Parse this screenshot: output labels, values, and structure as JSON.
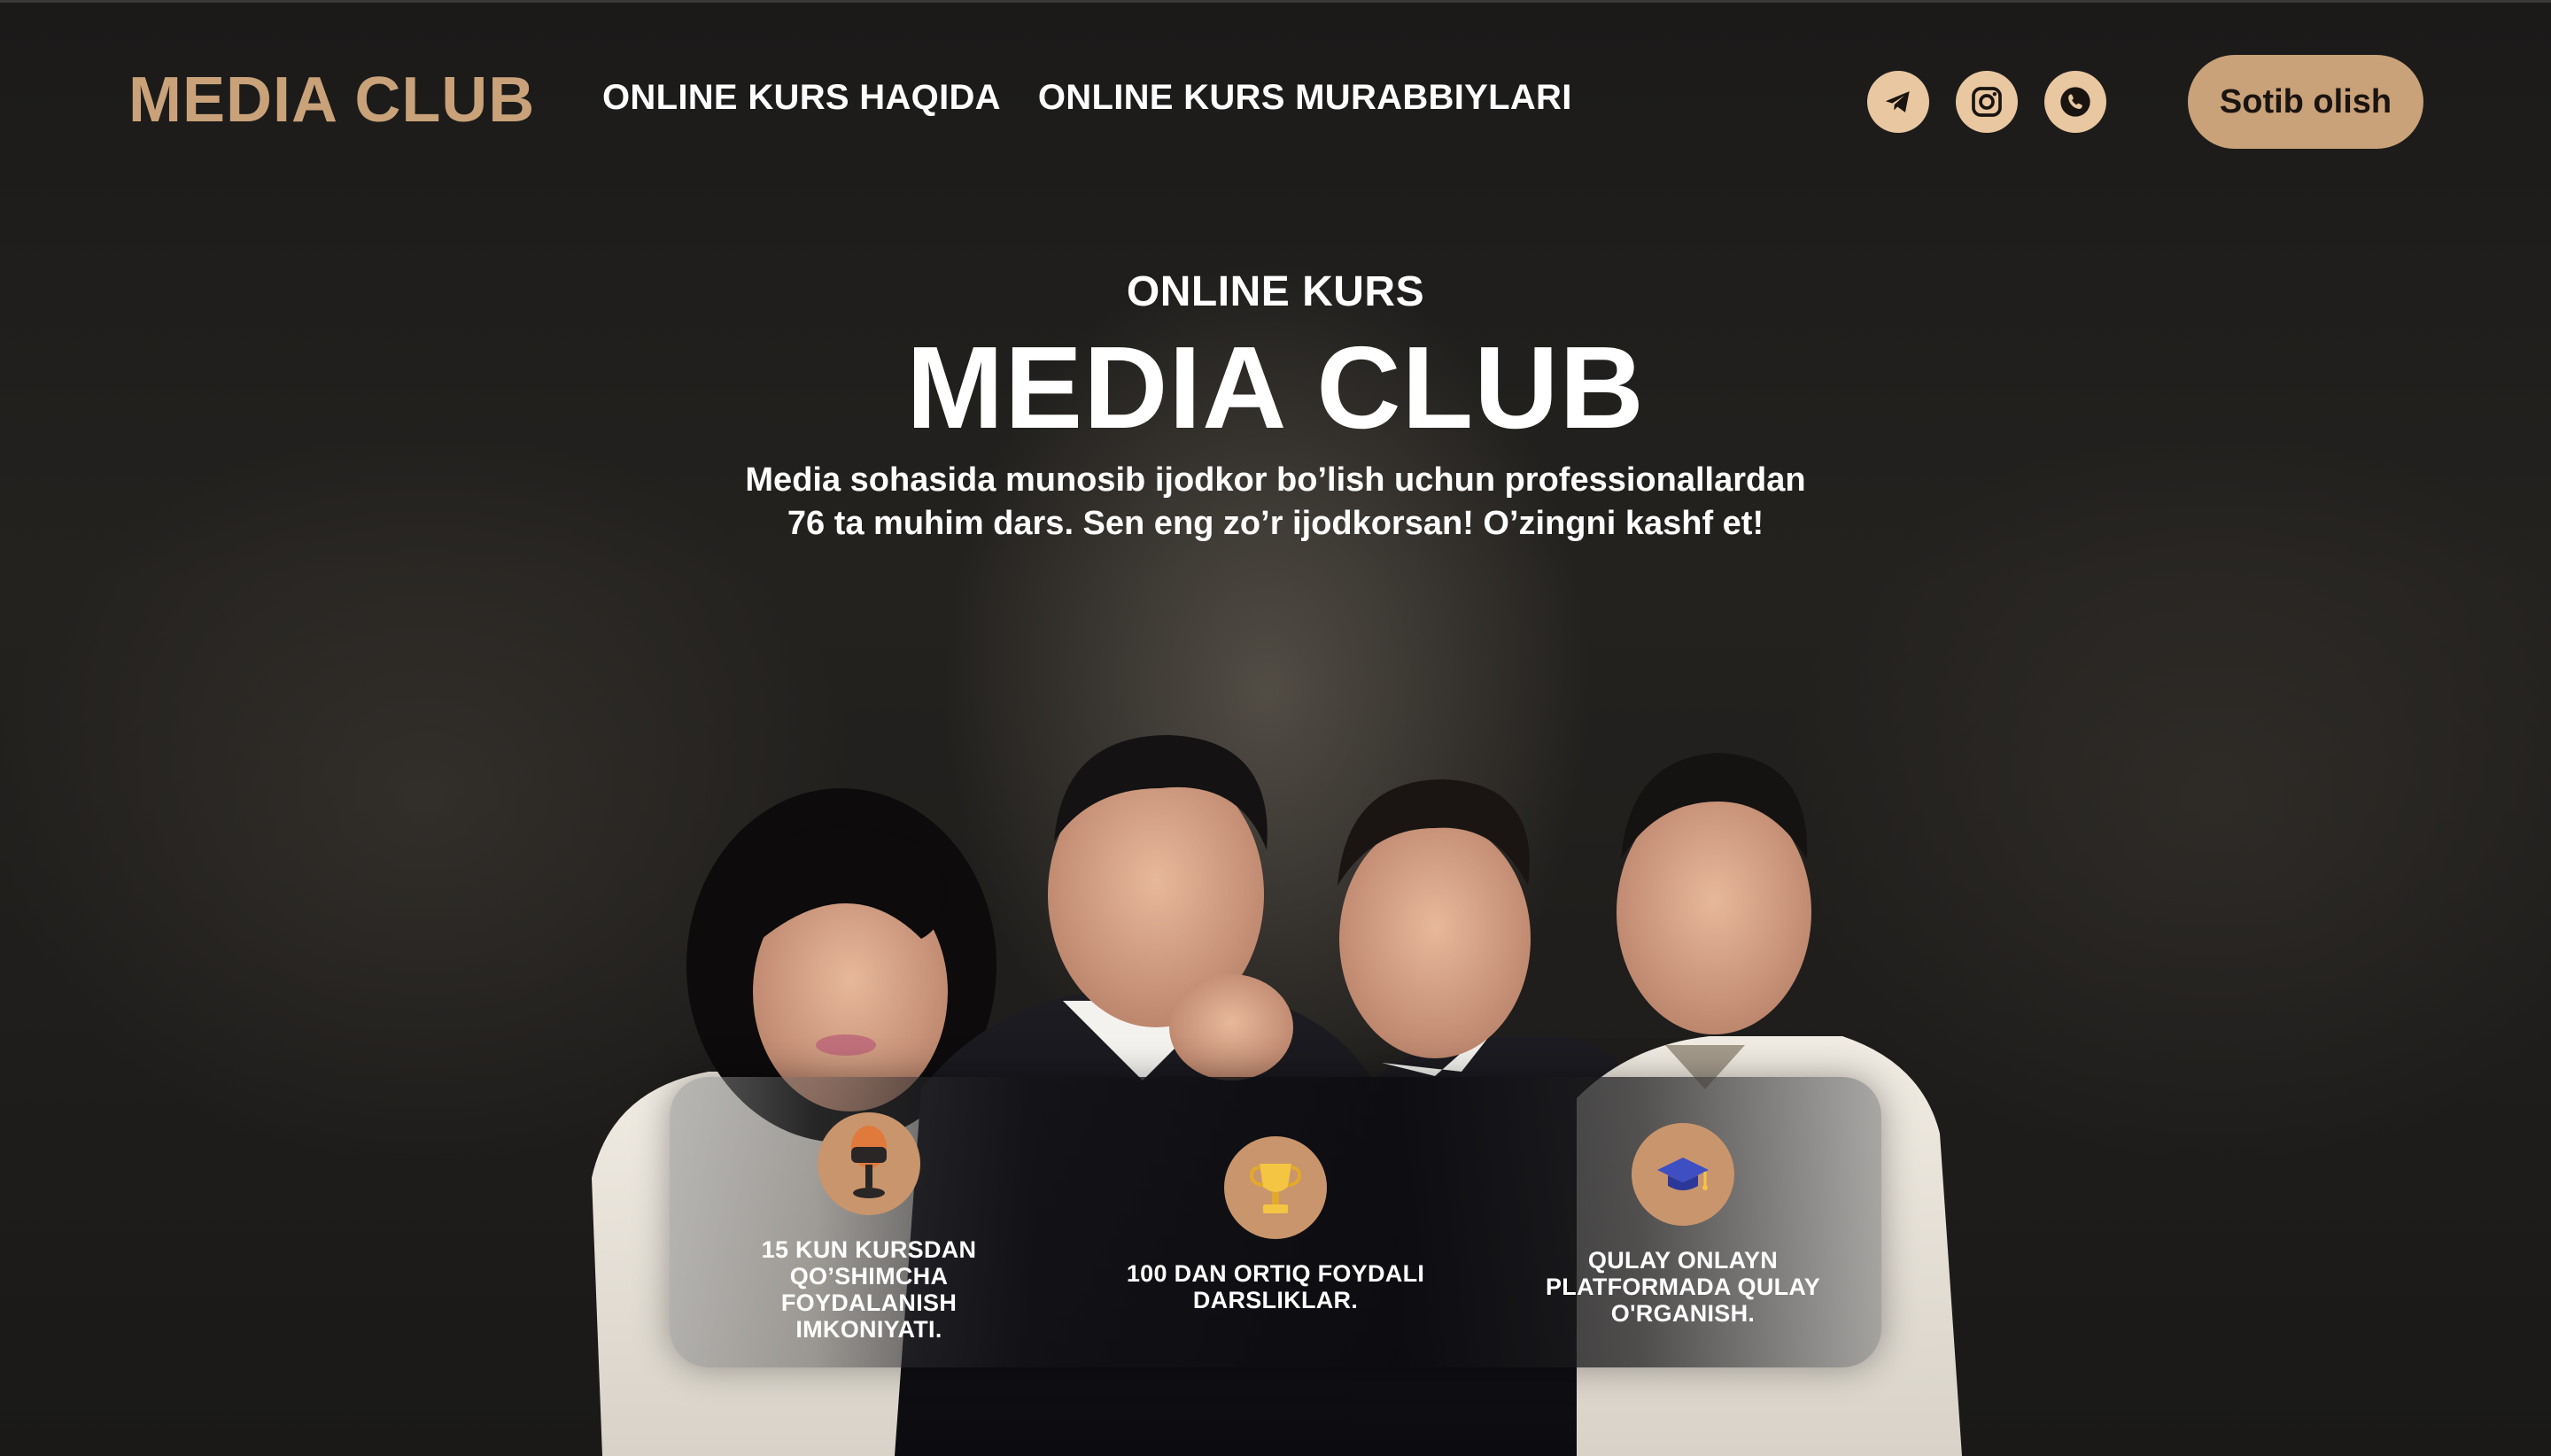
{
  "header": {
    "logo": "MEDIA CLUB",
    "nav": [
      {
        "label": "ONLINE KURS HAQIDA"
      },
      {
        "label": "ONLINE KURS MURABBIYLARI"
      }
    ],
    "socials": [
      {
        "icon": "telegram-icon"
      },
      {
        "icon": "instagram-icon"
      },
      {
        "icon": "phone-icon"
      }
    ],
    "buy_label": "Sotib olish"
  },
  "hero": {
    "kicker": "ONLINE KURS",
    "title": "MEDIA CLUB",
    "subtitle_line1": "Media sohasida munosib ijodkor bo’lish uchun professionallardan",
    "subtitle_line2": "76 ta muhim dars. Sen eng zo’r ijodkorsan! O’zingni kashf et!"
  },
  "features": [
    {
      "icon": "microphone-icon",
      "label": "15 KUN KURSDAN QO’SHIMCHA FOYDALANISH IMKONIYATI."
    },
    {
      "icon": "trophy-icon",
      "label": "100 DAN ORTIQ FOYDALI DARSLIKLAR."
    },
    {
      "icon": "graduation-cap-icon",
      "label": "QULAY ONLAYN PLATFORMADA QULAY O'RGANISH."
    }
  ],
  "colors": {
    "accent": "#c9a27a",
    "icon_circle": "#e8c7a1",
    "feature_circle": "#c9956d",
    "background": "#1b1a19"
  }
}
